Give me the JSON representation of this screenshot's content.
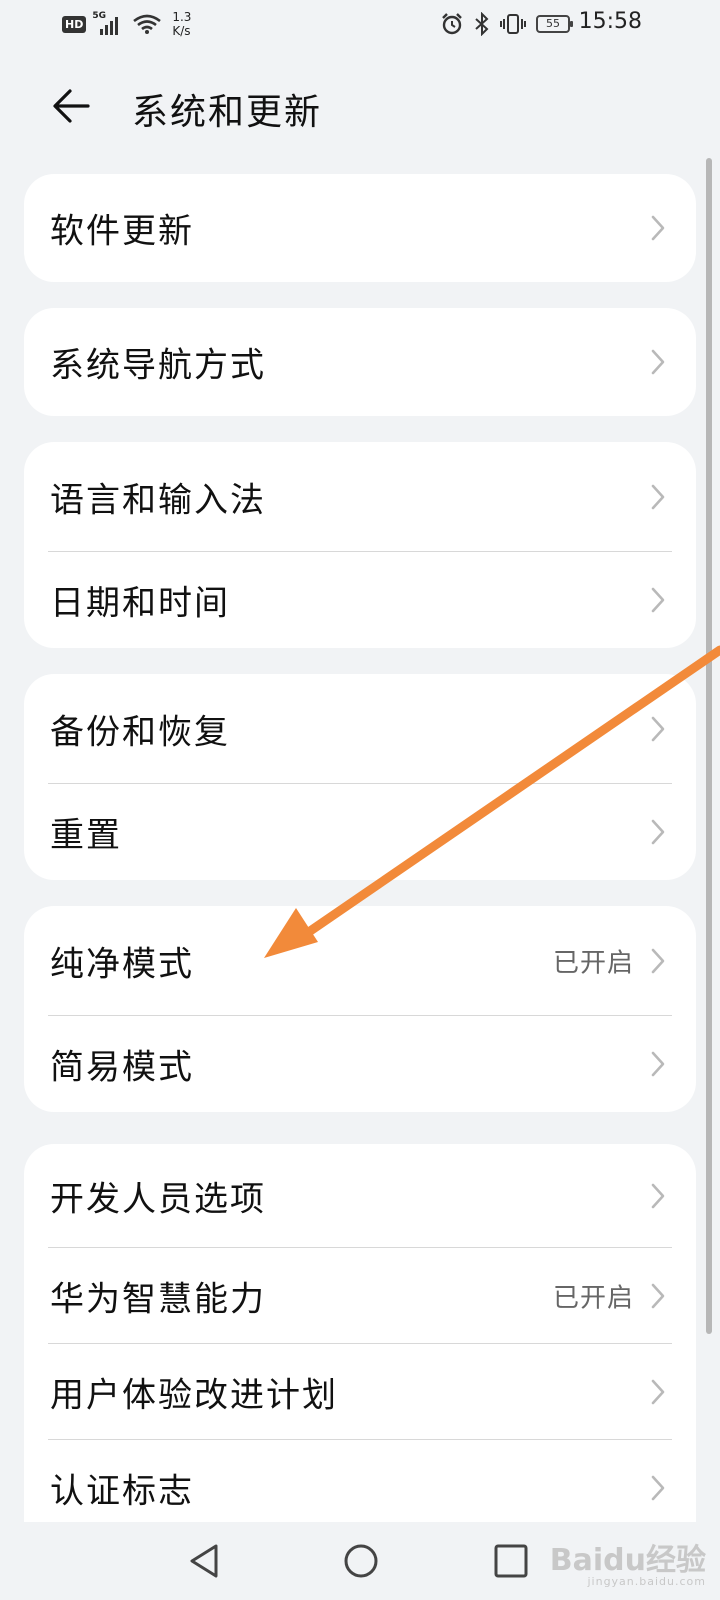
{
  "status_bar": {
    "hd_label": "HD",
    "network_label": "5G",
    "net_speed_value": "1.3",
    "net_speed_unit": "K/s",
    "battery": "55",
    "time": "15:58"
  },
  "header": {
    "title": "系统和更新"
  },
  "groups": [
    {
      "items": [
        {
          "label": "软件更新",
          "status": ""
        }
      ]
    },
    {
      "items": [
        {
          "label": "系统导航方式",
          "status": ""
        }
      ]
    },
    {
      "items": [
        {
          "label": "语言和输入法",
          "status": ""
        },
        {
          "label": "日期和时间",
          "status": ""
        }
      ]
    },
    {
      "items": [
        {
          "label": "备份和恢复",
          "status": ""
        },
        {
          "label": "重置",
          "status": ""
        }
      ]
    },
    {
      "items": [
        {
          "label": "纯净模式",
          "status": "已开启"
        },
        {
          "label": "简易模式",
          "status": ""
        }
      ]
    },
    {
      "items": [
        {
          "label": "开发人员选项",
          "status": ""
        },
        {
          "label": "华为智慧能力",
          "status": "已开启"
        },
        {
          "label": "用户体验改进计划",
          "status": ""
        },
        {
          "label": "认证标志",
          "status": ""
        }
      ]
    }
  ],
  "watermark": {
    "brand": "Baidu经验",
    "url": "jingyan.baidu.com"
  },
  "colors": {
    "background": "#f1f3f5",
    "card": "#ffffff",
    "annotation_arrow": "#f28a3a"
  }
}
